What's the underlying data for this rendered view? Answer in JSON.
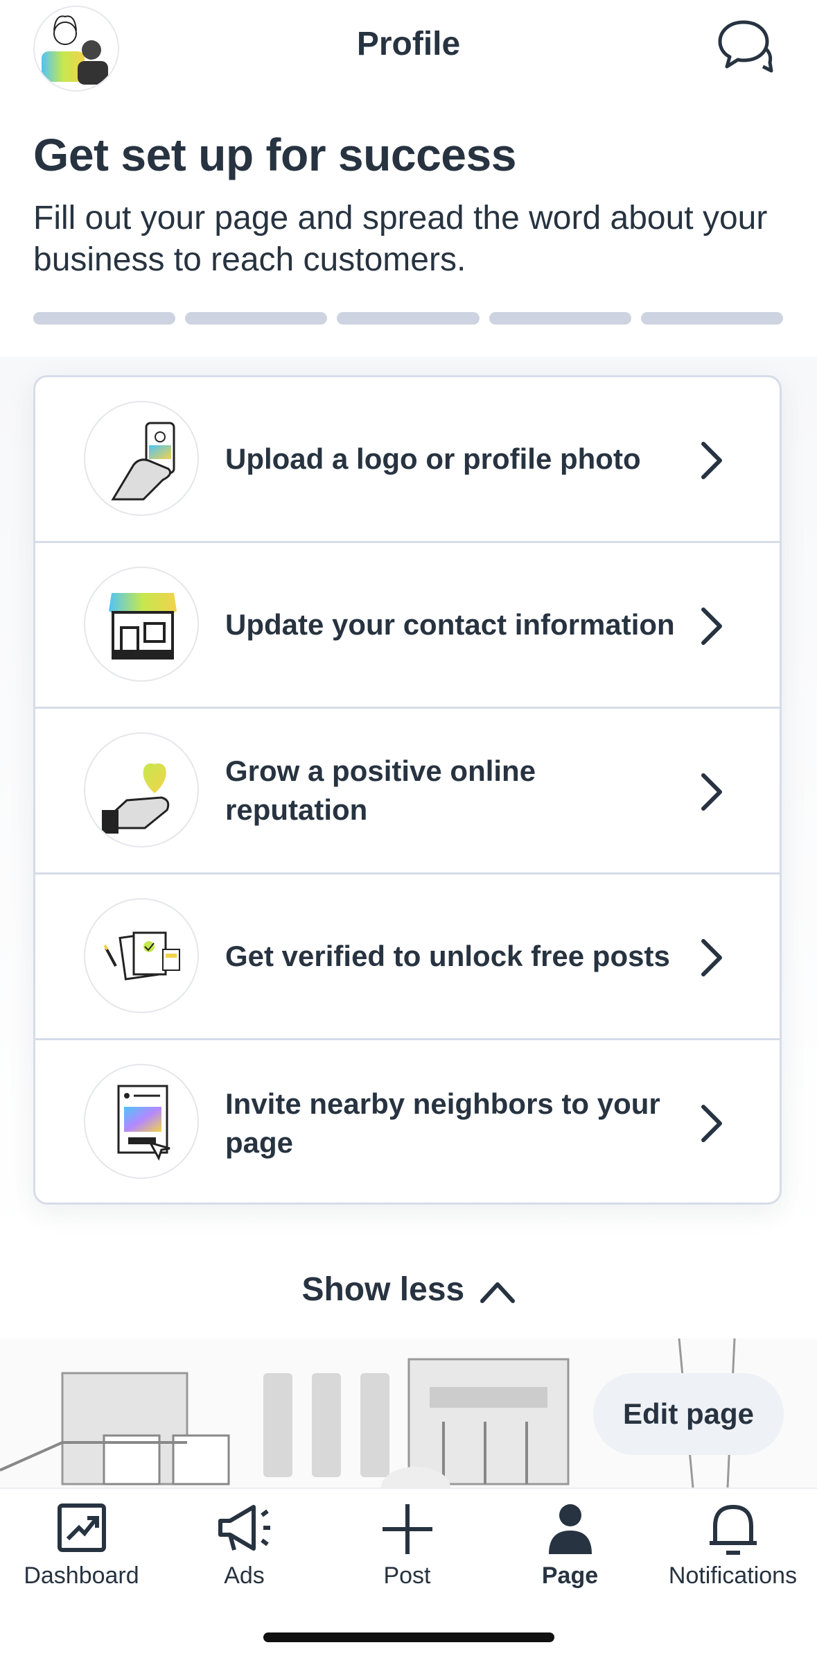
{
  "header": {
    "title": "Profile",
    "avatar_icon": "business-avatar",
    "chat_icon": "chat-bubbles-icon"
  },
  "intro": {
    "heading": "Get set up for success",
    "subtitle": "Fill out your page and spread the word about your business to reach customers."
  },
  "progress": {
    "segments_total": 5,
    "segments_complete": 0
  },
  "tasks": [
    {
      "label": "Upload a logo or profile photo",
      "icon": "phone-hand-icon"
    },
    {
      "label": "Update your contact information",
      "icon": "storefront-icon"
    },
    {
      "label": "Grow a positive online reputation",
      "icon": "heart-hand-icon"
    },
    {
      "label": "Get verified to unlock free posts",
      "icon": "documents-icon"
    },
    {
      "label": "Invite nearby neighbors to your page",
      "icon": "flyer-icon"
    }
  ],
  "show_less": "Show less",
  "edit_page": "Edit page",
  "tabs": [
    {
      "label": "Dashboard",
      "icon": "dashboard-chart-icon",
      "active": false
    },
    {
      "label": "Ads",
      "icon": "megaphone-icon",
      "active": false
    },
    {
      "label": "Post",
      "icon": "plus-icon",
      "active": false
    },
    {
      "label": "Page",
      "icon": "person-icon",
      "active": true
    },
    {
      "label": "Notifications",
      "icon": "bell-icon",
      "active": false
    }
  ]
}
